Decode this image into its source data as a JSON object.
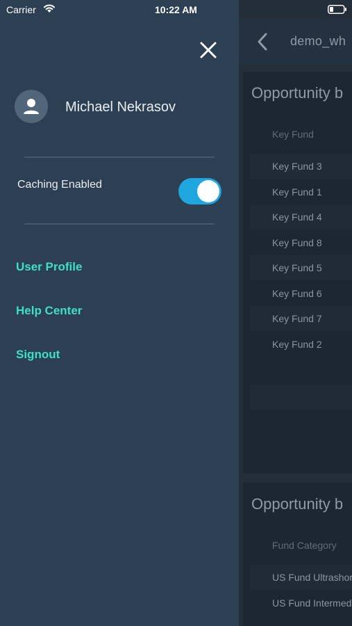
{
  "status_bar": {
    "carrier": "Carrier",
    "time": "10:22 AM"
  },
  "background_screen": {
    "title": "demo_wh",
    "cards": [
      {
        "title": "Opportunity b",
        "column_header": "Key Fund",
        "rows": [
          "Key Fund 3",
          "Key Fund 1",
          "Key Fund 4",
          "Key Fund 8",
          "Key Fund 5",
          "Key Fund 6",
          "Key Fund 7",
          "Key Fund 2"
        ]
      },
      {
        "title": "Opportunity b",
        "column_header": "Fund Category",
        "rows": [
          "US Fund Ultrashor",
          "US Fund Intermed"
        ]
      }
    ]
  },
  "drawer": {
    "user_name": "Michael Nekrasov",
    "caching_label": "Caching Enabled",
    "caching_enabled": true,
    "menu": {
      "user_profile": "User Profile",
      "help_center": "Help Center",
      "signout": "Signout"
    }
  },
  "colors": {
    "drawer_bg": "#2d4053",
    "accent_link": "#3ee0c4",
    "toggle_on": "#1ea6de"
  }
}
